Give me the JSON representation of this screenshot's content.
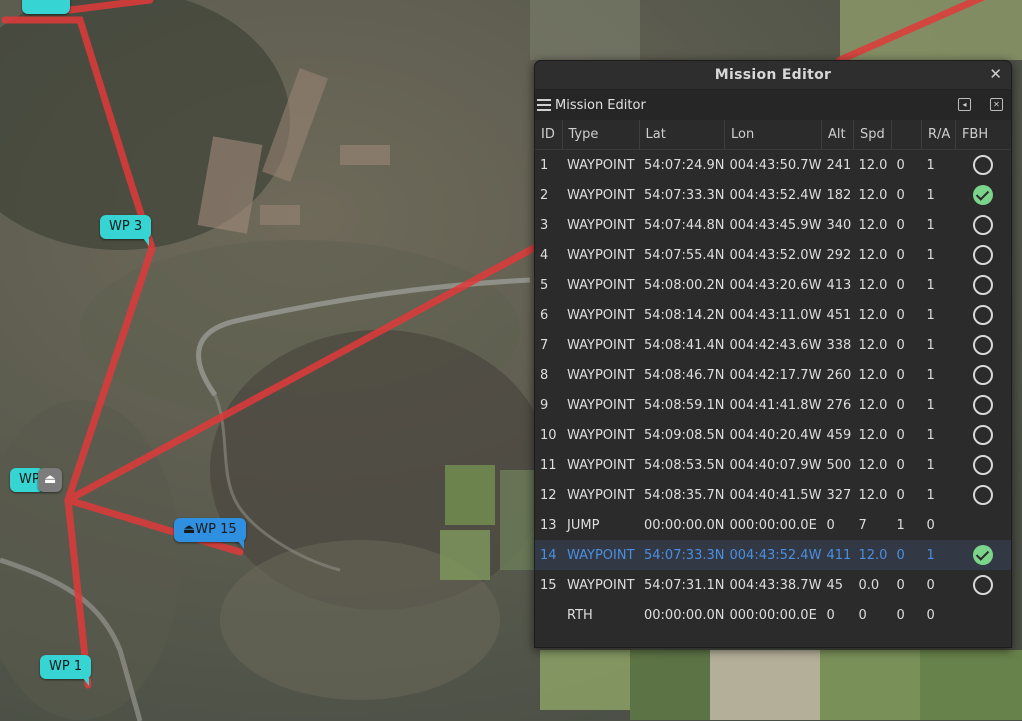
{
  "map": {
    "markers": {
      "wp3": "WP 3",
      "wp15": "WP 15",
      "wp1": "WP 1",
      "home_partial": "WP"
    },
    "route_color": "#e03a3a",
    "home_icon": "eject-icon"
  },
  "editor": {
    "window_title": "Mission Editor",
    "panel_title": "Mission Editor",
    "close_icon": "close-icon",
    "columns": [
      "ID",
      "Type",
      "Lat",
      "Lon",
      "Alt",
      "Spd",
      "",
      "R/A",
      "FBH"
    ],
    "rows": [
      {
        "id": "1",
        "type": "WAYPOINT",
        "lat": "54:07:24.9N",
        "lon": "004:43:50.7W",
        "alt": "241",
        "spd": "12.0",
        "p3": "0",
        "ra": "1",
        "fbh": "off"
      },
      {
        "id": "2",
        "type": "WAYPOINT",
        "lat": "54:07:33.3N",
        "lon": "004:43:52.4W",
        "alt": "182",
        "spd": "12.0",
        "p3": "0",
        "ra": "1",
        "fbh": "on"
      },
      {
        "id": "3",
        "type": "WAYPOINT",
        "lat": "54:07:44.8N",
        "lon": "004:43:45.9W",
        "alt": "340",
        "spd": "12.0",
        "p3": "0",
        "ra": "1",
        "fbh": "off"
      },
      {
        "id": "4",
        "type": "WAYPOINT",
        "lat": "54:07:55.4N",
        "lon": "004:43:52.0W",
        "alt": "292",
        "spd": "12.0",
        "p3": "0",
        "ra": "1",
        "fbh": "off"
      },
      {
        "id": "5",
        "type": "WAYPOINT",
        "lat": "54:08:00.2N",
        "lon": "004:43:20.6W",
        "alt": "413",
        "spd": "12.0",
        "p3": "0",
        "ra": "1",
        "fbh": "off"
      },
      {
        "id": "6",
        "type": "WAYPOINT",
        "lat": "54:08:14.2N",
        "lon": "004:43:11.0W",
        "alt": "451",
        "spd": "12.0",
        "p3": "0",
        "ra": "1",
        "fbh": "off"
      },
      {
        "id": "7",
        "type": "WAYPOINT",
        "lat": "54:08:41.4N",
        "lon": "004:42:43.6W",
        "alt": "338",
        "spd": "12.0",
        "p3": "0",
        "ra": "1",
        "fbh": "off"
      },
      {
        "id": "8",
        "type": "WAYPOINT",
        "lat": "54:08:46.7N",
        "lon": "004:42:17.7W",
        "alt": "260",
        "spd": "12.0",
        "p3": "0",
        "ra": "1",
        "fbh": "off"
      },
      {
        "id": "9",
        "type": "WAYPOINT",
        "lat": "54:08:59.1N",
        "lon": "004:41:41.8W",
        "alt": "276",
        "spd": "12.0",
        "p3": "0",
        "ra": "1",
        "fbh": "off"
      },
      {
        "id": "10",
        "type": "WAYPOINT",
        "lat": "54:09:08.5N",
        "lon": "004:40:20.4W",
        "alt": "459",
        "spd": "12.0",
        "p3": "0",
        "ra": "1",
        "fbh": "off"
      },
      {
        "id": "11",
        "type": "WAYPOINT",
        "lat": "54:08:53.5N",
        "lon": "004:40:07.9W",
        "alt": "500",
        "spd": "12.0",
        "p3": "0",
        "ra": "1",
        "fbh": "off"
      },
      {
        "id": "12",
        "type": "WAYPOINT",
        "lat": "54:08:35.7N",
        "lon": "004:40:41.5W",
        "alt": "327",
        "spd": "12.0",
        "p3": "0",
        "ra": "1",
        "fbh": "off"
      },
      {
        "id": "13",
        "type": "JUMP",
        "lat": "00:00:00.0N",
        "lon": "000:00:00.0E",
        "alt": "0",
        "spd": "7",
        "p3": "1",
        "ra": "0",
        "fbh": "none"
      },
      {
        "id": "14",
        "type": "WAYPOINT",
        "lat": "54:07:33.3N",
        "lon": "004:43:52.4W",
        "alt": "411",
        "spd": "12.0",
        "p3": "0",
        "ra": "1",
        "fbh": "on",
        "selected": true
      },
      {
        "id": "15",
        "type": "WAYPOINT",
        "lat": "54:07:31.1N",
        "lon": "004:43:38.7W",
        "alt": "45",
        "spd": "0.0",
        "p3": "0",
        "ra": "0",
        "fbh": "off"
      },
      {
        "id": "",
        "type": "RTH",
        "lat": "00:00:00.0N",
        "lon": "000:00:00.0E",
        "alt": "0",
        "spd": "0",
        "p3": "0",
        "ra": "0",
        "fbh": "none"
      }
    ]
  }
}
